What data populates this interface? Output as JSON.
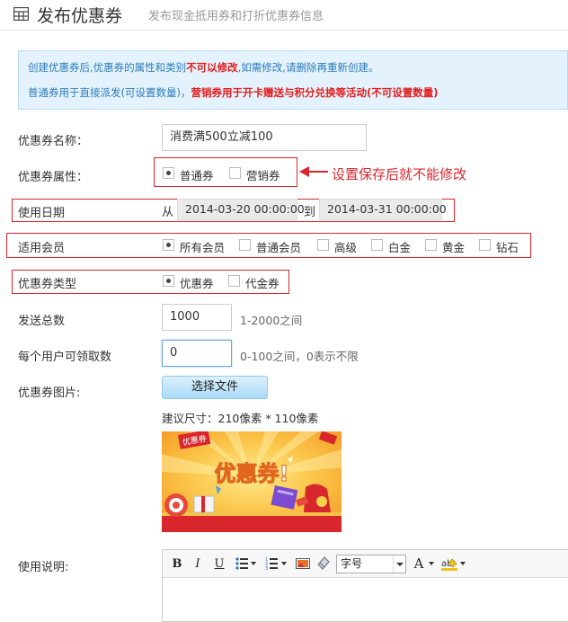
{
  "header": {
    "title": "发布优惠券",
    "subtitle": "发布现金抵用券和打折优惠券信息",
    "icon": "grid-icon"
  },
  "notice": {
    "line1_prefix": "创建优惠券后,优惠券的属性和类别",
    "line1_emphasis": "不可以修改",
    "line1_suffix": ",如需修改,请删除再重新创建。",
    "line2_prefix": "普通券用于直接派发(可设置数量)，",
    "line2_emphasis": "营销券用于开卡赠送与积分兑换等活动(不可设置数量)"
  },
  "form": {
    "name": {
      "label": "优惠券名称：",
      "value": "消费满500立减100"
    },
    "attribute": {
      "label": "优惠券属性：",
      "options": [
        {
          "label": "普通券",
          "checked": true
        },
        {
          "label": "营销券",
          "checked": false
        }
      ],
      "annotation": "设置保存后就不能修改"
    },
    "date": {
      "label": "使用日期",
      "from_label": "从",
      "from": "2014-03-20 00:00:00",
      "to_label": "到",
      "to": "2014-03-31 00:00:00"
    },
    "members": {
      "label": "适用会员",
      "options": [
        {
          "label": "所有会员",
          "checked": true
        },
        {
          "label": "普通会员",
          "checked": false
        },
        {
          "label": "高级",
          "checked": false
        },
        {
          "label": "白金",
          "checked": false
        },
        {
          "label": "黄金",
          "checked": false
        },
        {
          "label": "钻石",
          "checked": false
        }
      ]
    },
    "type": {
      "label": "优惠券类型",
      "options": [
        {
          "label": "优惠券",
          "checked": true
        },
        {
          "label": "代金券",
          "checked": false
        }
      ]
    },
    "total": {
      "label": "发送总数",
      "value": "1000",
      "hint": "1-2000之间"
    },
    "per_user": {
      "label": "每个用户可领取数",
      "value": "0",
      "hint": "0-100之间，0表示不限"
    },
    "image": {
      "label": "优惠券图片:",
      "button": "选择文件",
      "size_hint": "建议尺寸：210像素 * 110像素",
      "banner_text": "优惠券!",
      "banner_tag": "优惠券"
    },
    "description": {
      "label": "使用说明:",
      "toolbar": {
        "bold": "B",
        "italic": "I",
        "underline": "U",
        "font_size": "字号",
        "font_color": "A"
      }
    }
  },
  "colors": {
    "accent_red": "#d9272e",
    "notice_bg": "#e3f2fc",
    "notice_text": "#2b7cba"
  }
}
